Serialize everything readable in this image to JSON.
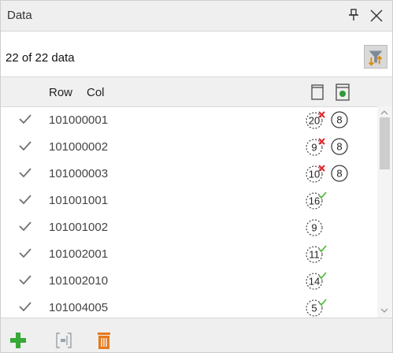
{
  "window": {
    "title": "Data"
  },
  "summary": {
    "count_text": "22 of 22 data"
  },
  "header": {
    "row_label": "Row",
    "col_label": "Col"
  },
  "rows": [
    {
      "id": "101000001",
      "count": "20",
      "status": "error",
      "extra": "8"
    },
    {
      "id": "101000002",
      "count": "9",
      "status": "error",
      "extra": "8"
    },
    {
      "id": "101000003",
      "count": "10",
      "status": "error",
      "extra": "8"
    },
    {
      "id": "101001001",
      "count": "16",
      "status": "ok",
      "extra": ""
    },
    {
      "id": "101001002",
      "count": "9",
      "status": "none",
      "extra": ""
    },
    {
      "id": "101002001",
      "count": "11",
      "status": "ok",
      "extra": ""
    },
    {
      "id": "101002010",
      "count": "14",
      "status": "ok",
      "extra": ""
    },
    {
      "id": "101004005",
      "count": "5",
      "status": "ok",
      "extra": ""
    }
  ],
  "colors": {
    "error": "#e0242a",
    "ok": "#5cbf4a",
    "add": "#38a838",
    "delete": "#e57a1e",
    "filter": "#7e8a98"
  }
}
